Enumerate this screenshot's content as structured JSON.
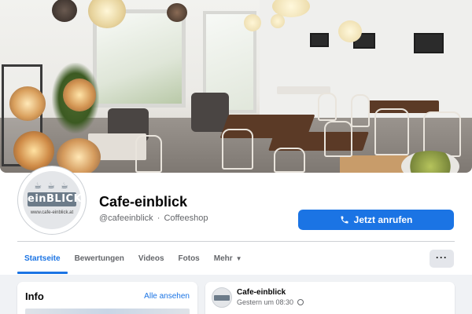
{
  "page": {
    "name": "Cafe-einblick",
    "handle": "@cafeeinblick",
    "category": "Coffeeshop",
    "separator": "·"
  },
  "avatar": {
    "logo_text": "einBLICK",
    "url": "www.cafe-einblick.at"
  },
  "actions": {
    "call_label": "Jetzt anrufen",
    "call_icon": "phone-icon",
    "more_icon": "more-icon"
  },
  "tabs": [
    {
      "label": "Startseite",
      "active": true
    },
    {
      "label": "Bewertungen",
      "active": false
    },
    {
      "label": "Videos",
      "active": false
    },
    {
      "label": "Fotos",
      "active": false
    },
    {
      "label": "Mehr",
      "active": false
    }
  ],
  "info_card": {
    "title": "Info",
    "see_all": "Alle ansehen"
  },
  "post": {
    "author": "Cafe-einblick",
    "time": "Gestern um 08:30",
    "visibility_icon": "globe-icon"
  },
  "colors": {
    "accent": "#1b74e4",
    "background": "#f0f2f5",
    "secondary_text": "#65676b"
  }
}
